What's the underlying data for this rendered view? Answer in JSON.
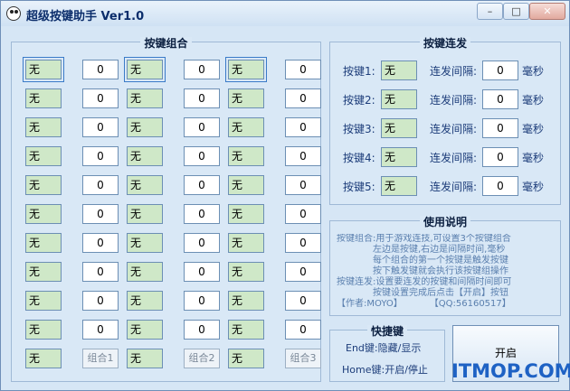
{
  "window": {
    "title": "超级按键助手 Ver1.0",
    "minimize": "–",
    "maximize": "□",
    "close": "✕"
  },
  "combo": {
    "title": "按键组合",
    "rows": [
      {
        "k1": "无",
        "v1": "0",
        "k2": "无",
        "v2": "0",
        "k3": "无",
        "v3": "0"
      },
      {
        "k1": "无",
        "v1": "0",
        "k2": "无",
        "v2": "0",
        "k3": "无",
        "v3": "0"
      },
      {
        "k1": "无",
        "v1": "0",
        "k2": "无",
        "v2": "0",
        "k3": "无",
        "v3": "0"
      },
      {
        "k1": "无",
        "v1": "0",
        "k2": "无",
        "v2": "0",
        "k3": "无",
        "v3": "0"
      },
      {
        "k1": "无",
        "v1": "0",
        "k2": "无",
        "v2": "0",
        "k3": "无",
        "v3": "0"
      },
      {
        "k1": "无",
        "v1": "0",
        "k2": "无",
        "v2": "0",
        "k3": "无",
        "v3": "0"
      },
      {
        "k1": "无",
        "v1": "0",
        "k2": "无",
        "v2": "0",
        "k3": "无",
        "v3": "0"
      },
      {
        "k1": "无",
        "v1": "0",
        "k2": "无",
        "v2": "0",
        "k3": "无",
        "v3": "0"
      },
      {
        "k1": "无",
        "v1": "0",
        "k2": "无",
        "v2": "0",
        "k3": "无",
        "v3": "0"
      },
      {
        "k1": "无",
        "v1": "0",
        "k2": "无",
        "v2": "0",
        "k3": "无",
        "v3": "0"
      }
    ],
    "footer": {
      "k1": "无",
      "b1": "组合1",
      "k2": "无",
      "b2": "组合2",
      "k3": "无",
      "b3": "组合3"
    }
  },
  "burst": {
    "title": "按键连发",
    "items": [
      {
        "label": "按键1:",
        "key": "无",
        "interval_label": "连发间隔:",
        "interval": "0",
        "unit": "毫秒"
      },
      {
        "label": "按键2:",
        "key": "无",
        "interval_label": "连发间隔:",
        "interval": "0",
        "unit": "毫秒"
      },
      {
        "label": "按键3:",
        "key": "无",
        "interval_label": "连发间隔:",
        "interval": "0",
        "unit": "毫秒"
      },
      {
        "label": "按键4:",
        "key": "无",
        "interval_label": "连发间隔:",
        "interval": "0",
        "unit": "毫秒"
      },
      {
        "label": "按键5:",
        "key": "无",
        "interval_label": "连发间隔:",
        "interval": "0",
        "unit": "毫秒"
      }
    ]
  },
  "help": {
    "title": "使用说明",
    "lines": [
      "按键组合:用于游戏连技,可设置3个按键组合",
      "　　　　左边是按键,右边是间隔时间,毫秒",
      "　　　　每个组合的第一个按键是触发按键",
      "　　　　按下触发键就会执行该按键组操作",
      "按键连发:设置要连发的按键和间隔时间即可",
      "　　　　按键设置完成后点击【开启】按钮",
      "【作者:MOYO】　　　　【QQ:56160517】"
    ]
  },
  "hotkeys": {
    "title": "快捷键",
    "line1": "End键:隐藏/显示",
    "line2": "Home键:开启/停止"
  },
  "start_button": "开启",
  "watermark": "ITMOP.COM"
}
